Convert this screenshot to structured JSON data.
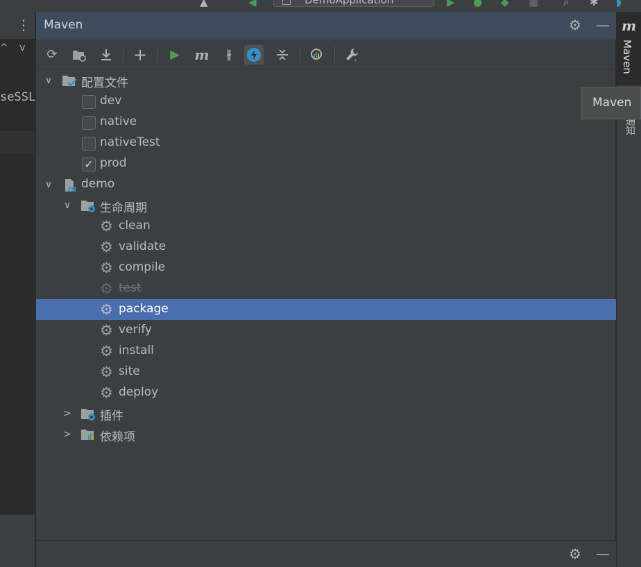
{
  "top_strip": {
    "run_config_label": "DemoApplication"
  },
  "left_panel": {
    "more_glyph": "⋮",
    "arrows": "^ v",
    "code_text": "seSSL"
  },
  "maven": {
    "title": "Maven",
    "header_icons": [
      "gear-icon",
      "minimize-icon"
    ],
    "toolbar": [
      {
        "name": "reload-all-projects",
        "icon": "refresh-icon"
      },
      {
        "name": "generate-sources",
        "icon": "folder-refresh-icon"
      },
      {
        "name": "download-sources",
        "icon": "download-icon"
      },
      {
        "name": "add-maven-project",
        "icon": "plus-icon"
      },
      {
        "name": "run-maven-build",
        "icon": "play-icon"
      },
      {
        "name": "execute-maven-goal",
        "icon": "m-icon"
      },
      {
        "name": "toggle-skip-tests",
        "icon": "skip-tests-icon"
      },
      {
        "name": "toggle-offline-mode",
        "icon": "offline-icon",
        "active": true
      },
      {
        "name": "collapse-all",
        "icon": "collapse-icon"
      },
      {
        "name": "analyze-dependencies",
        "icon": "analyze-icon"
      },
      {
        "name": "maven-settings",
        "icon": "wrench-icon"
      }
    ],
    "tree": {
      "profiles": {
        "label": "配置文件",
        "items": [
          {
            "label": "dev",
            "checked": false
          },
          {
            "label": "native",
            "checked": false
          },
          {
            "label": "nativeTest",
            "checked": false
          },
          {
            "label": "prod",
            "checked": true
          }
        ]
      },
      "project": {
        "label": "demo",
        "lifecycle": {
          "label": "生命周期",
          "goals": [
            {
              "label": "clean",
              "disabled": false,
              "selected": false
            },
            {
              "label": "validate",
              "disabled": false,
              "selected": false
            },
            {
              "label": "compile",
              "disabled": false,
              "selected": false
            },
            {
              "label": "test",
              "disabled": true,
              "selected": false
            },
            {
              "label": "package",
              "disabled": false,
              "selected": true
            },
            {
              "label": "verify",
              "disabled": false,
              "selected": false
            },
            {
              "label": "install",
              "disabled": false,
              "selected": false
            },
            {
              "label": "site",
              "disabled": false,
              "selected": false
            },
            {
              "label": "deploy",
              "disabled": false,
              "selected": false
            }
          ]
        },
        "plugins": {
          "label": "插件"
        },
        "dependencies": {
          "label": "依赖项"
        }
      }
    }
  },
  "right_stripe": {
    "maven_tab_label": "Maven",
    "notifications_label": "通知"
  },
  "tooltip": {
    "text": "Maven"
  },
  "colors": {
    "selection": "#4b6eaf",
    "header": "#3d4b5c",
    "panel": "#3c3f41",
    "run_green": "#499c54",
    "accent_blue": "#3592c4"
  }
}
